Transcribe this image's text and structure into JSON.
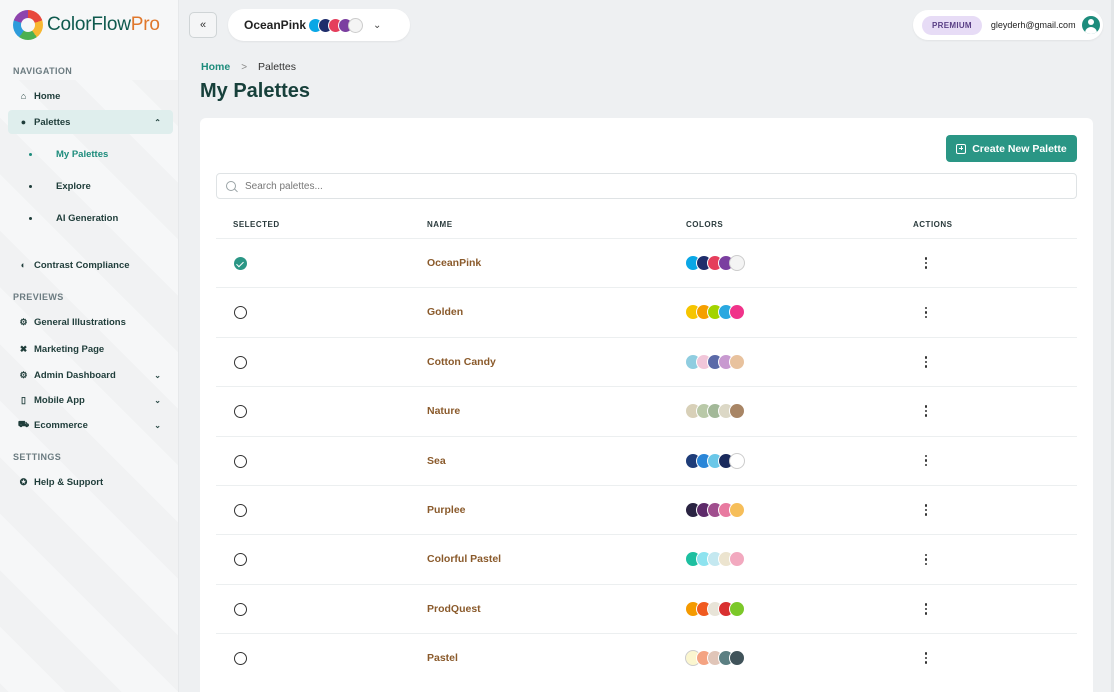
{
  "app": {
    "name_part1": "ColorFlow",
    "name_part2": "Pro"
  },
  "sidebar": {
    "sections": [
      "NAVIGATION",
      "PREVIEWS",
      "SETTINGS"
    ],
    "nav": [
      {
        "label": "Home",
        "icon": "home-icon"
      },
      {
        "label": "Palettes",
        "icon": "palette-icon",
        "expanded": true
      },
      {
        "label": "Contrast Compliance",
        "icon": "contrast-icon"
      }
    ],
    "palettes_sub": [
      {
        "label": "My Palettes",
        "active": true
      },
      {
        "label": "Explore"
      },
      {
        "label": "AI Generation"
      }
    ],
    "previews": [
      {
        "label": "General Illustrations",
        "icon": "illustrations-icon"
      },
      {
        "label": "Marketing Page",
        "icon": "tools-icon"
      },
      {
        "label": "Admin Dashboard",
        "icon": "dashboard-icon"
      },
      {
        "label": "Mobile App",
        "icon": "mobile-icon"
      },
      {
        "label": "Ecommerce",
        "icon": "cart-icon"
      }
    ],
    "settings": [
      {
        "label": "Help & Support",
        "icon": "help-icon"
      }
    ]
  },
  "topbar": {
    "collapse_label": "«",
    "current_palette": "OceanPink",
    "current_palette_colors": [
      "#0aa7e6",
      "#1f2d6b",
      "#e53e5c",
      "#7b3fa0",
      "#f4f4f4"
    ],
    "badge": "PREMIUM",
    "email": "gleyderh@gmail.com"
  },
  "breadcrumb": {
    "home": "Home",
    "separator": ">",
    "current": "Palettes"
  },
  "page_title": "My Palettes",
  "actions": {
    "create_label": "Create New Palette"
  },
  "search": {
    "placeholder": "Search palettes...",
    "value": ""
  },
  "table": {
    "columns": [
      "SELECTED",
      "NAME",
      "COLORS",
      "ACTIONS"
    ],
    "rows": [
      {
        "name": "OceanPink",
        "selected": true,
        "colors": [
          "#0aa7e6",
          "#1f2d6b",
          "#e53e5c",
          "#7b3fa0",
          "#f4f4f4"
        ]
      },
      {
        "name": "Golden",
        "selected": false,
        "colors": [
          "#f6c500",
          "#f59f00",
          "#a3d400",
          "#2aa8e0",
          "#f0338a"
        ]
      },
      {
        "name": "Cotton Candy",
        "selected": false,
        "colors": [
          "#8fcde0",
          "#f1c6d9",
          "#5b6aa8",
          "#c89ad0",
          "#e8c29e"
        ]
      },
      {
        "name": "Nature",
        "selected": false,
        "colors": [
          "#d8d0b8",
          "#b9c9a8",
          "#a2b898",
          "#dcd8c6",
          "#a88565"
        ]
      },
      {
        "name": "Sea",
        "selected": false,
        "colors": [
          "#1e3c78",
          "#2a86d8",
          "#6ac7e8",
          "#1a2a5c",
          "#ffffff"
        ]
      },
      {
        "name": "Purplee",
        "selected": false,
        "colors": [
          "#2a2342",
          "#5e2b6a",
          "#a04e8e",
          "#e87aa0",
          "#f6be5a"
        ]
      },
      {
        "name": "Colorful Pastel",
        "selected": false,
        "colors": [
          "#1dbfa0",
          "#8ee3ef",
          "#c4e8f0",
          "#ece4cf",
          "#f2a9bf"
        ]
      },
      {
        "name": "ProdQuest",
        "selected": false,
        "colors": [
          "#f49a00",
          "#f05a1f",
          "#e8e4d8",
          "#d93030",
          "#7cc829"
        ]
      },
      {
        "name": "Pastel",
        "selected": false,
        "colors": [
          "#fbf6cf",
          "#f4a382",
          "#e0c5b8",
          "#5b7f82",
          "#40535a"
        ]
      }
    ]
  },
  "colors": {
    "accent": "#2a9685",
    "brand_dark": "#0f5a4e",
    "brand_orange": "#e0772b",
    "name_color": "#8a5a2b"
  }
}
